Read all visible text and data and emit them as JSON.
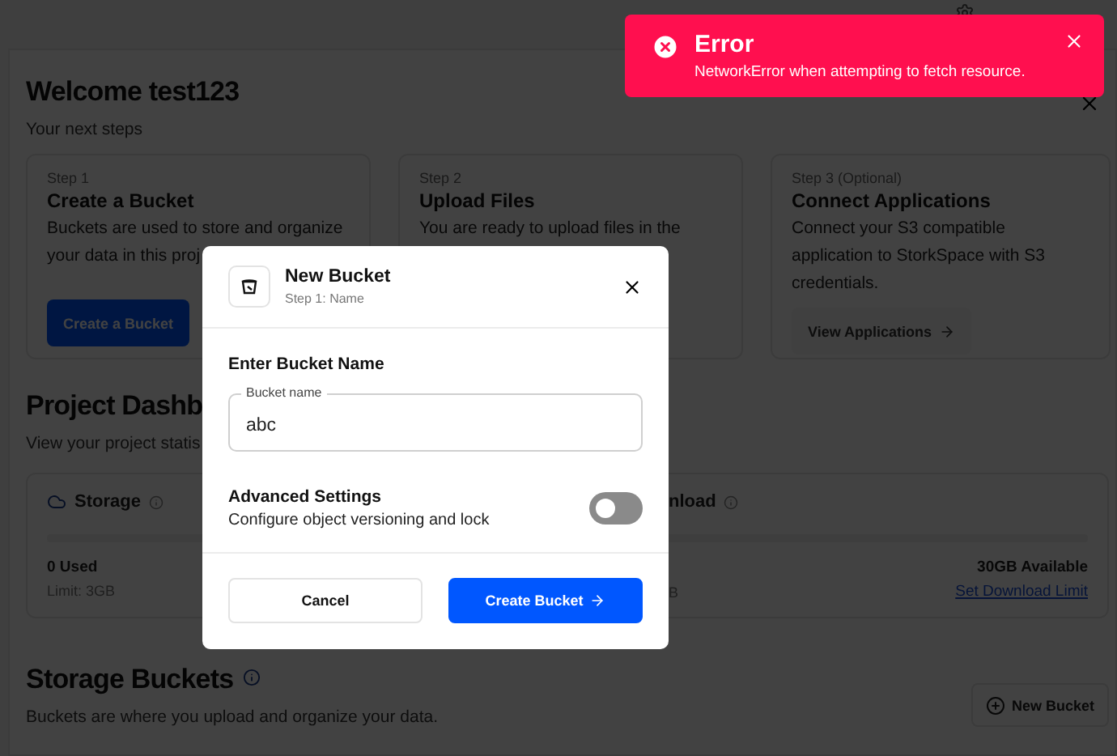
{
  "welcome": {
    "title": "Welcome test123",
    "subtitle": "Your next steps"
  },
  "steps": [
    {
      "step": "Step 1",
      "title": "Create a Bucket",
      "lines": [
        "Buckets are used to store and organize",
        "your data in this proj"
      ],
      "button": "Create a Bucket",
      "disabled": false
    },
    {
      "step": "Step 2",
      "title": "Upload Files",
      "lines": [
        "You are ready to upload files in the"
      ]
    },
    {
      "step": "Step 3 (Optional)",
      "title": "Connect Applications",
      "lines": [
        "Connect your S3 compatible",
        "application to StorkSpace with S3",
        "credentials."
      ],
      "button": "View Applications",
      "disabled": true
    }
  ],
  "dashboard": {
    "title": "Project Dashb",
    "subtitle": "View your project statis",
    "storage": {
      "label": "Storage",
      "used": "0 Used",
      "limit": "Limit: 3GB"
    },
    "download": {
      "label": "nload",
      "limit": "B",
      "available": "30GB Available",
      "link": "Set Download Limit"
    }
  },
  "buckets": {
    "title": "Storage Buckets",
    "description": "Buckets are where you upload and organize your data.",
    "button": "New Bucket"
  },
  "modal": {
    "title": "New Bucket",
    "subtitle": "Step 1: Name",
    "section": "Enter Bucket Name",
    "field_label": "Bucket name",
    "value": "abc",
    "advanced_title": "Advanced Settings",
    "advanced_description": "Configure object versioning and lock",
    "toggle_on": false,
    "cancel": "Cancel",
    "submit": "Create Bucket"
  },
  "toast": {
    "title": "Error",
    "message": "NetworkError when attempting to fetch resource."
  }
}
